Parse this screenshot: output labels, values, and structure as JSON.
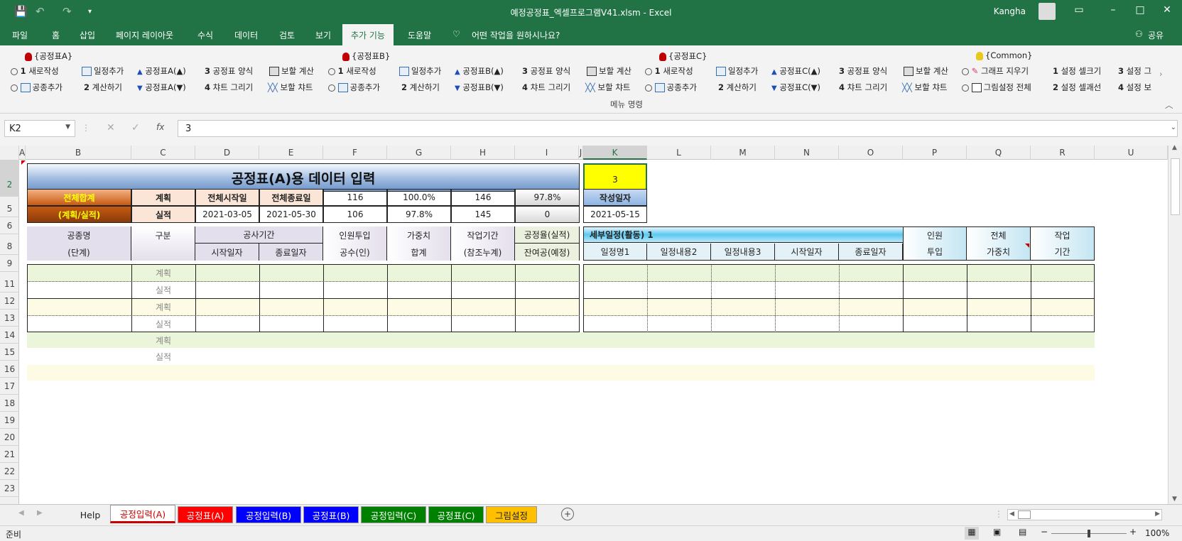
{
  "window": {
    "title": "예정공정표_엑셀프로그램V41.xlsm  -  Excel",
    "user": "Kangha"
  },
  "menu": {
    "tabs": [
      "파일",
      "홈",
      "삽입",
      "페이지 레이아웃",
      "수식",
      "데이터",
      "검토",
      "보기",
      "추가 기능",
      "도움말"
    ],
    "active": "추가 기능",
    "tell_me": "어떤 작업을 원하시나요?",
    "share": "공유"
  },
  "ribbon": {
    "groups": [
      {
        "title": "{공정표A}",
        "bulb": "#c00000",
        "row1": [
          "새로작성",
          "일정추가",
          "공정표A(▲)",
          "공정표 양식",
          "보할 계산"
        ],
        "row2": [
          "공종추가",
          "계산하기",
          "공정표A(▼)",
          "챠트 그리기",
          "보할 챠트"
        ]
      },
      {
        "title": "{공정표B}",
        "bulb": "#c00000",
        "row1": [
          "새로작성",
          "일정추가",
          "공정표B(▲)",
          "공정표 양식",
          "보할 계산"
        ],
        "row2": [
          "공종추가",
          "계산하기",
          "공정표B(▼)",
          "챠트 그리기",
          "보할 챠트"
        ]
      },
      {
        "title": "{공정표C}",
        "bulb": "#c00000",
        "row1": [
          "새로작성",
          "일정추가",
          "공정표C(▲)",
          "공정표 양식",
          "보할 계산"
        ],
        "row2": [
          "공종추가",
          "계산하기",
          "공정표C(▼)",
          "챠트 그리기",
          "보할 챠트"
        ]
      }
    ],
    "common": {
      "title": "{Common}",
      "bulb": "#e8c81a",
      "row1": [
        "그래프 지우기",
        "설정 셀크기",
        "설정 그"
      ],
      "row2": [
        "그림설정 전체",
        "설정 셀괘선",
        "설정 보"
      ]
    },
    "nums": {
      "n1": "1",
      "n2": "2",
      "n3": "3",
      "n4": "4"
    },
    "footer": "메뉴 명령"
  },
  "formula": {
    "namebox": "K2",
    "fx": "fx",
    "value": "3"
  },
  "columns": [
    "A",
    "B",
    "C",
    "D",
    "E",
    "F",
    "G",
    "H",
    "I",
    "J",
    "K",
    "L",
    "M",
    "N",
    "O",
    "P",
    "Q",
    "R",
    "U"
  ],
  "rows": [
    "2",
    "5",
    "6",
    "8",
    "9",
    "11",
    "12",
    "13",
    "14",
    "15",
    "16",
    "17",
    "18",
    "19",
    "20",
    "21",
    "22",
    "23"
  ],
  "sheet": {
    "title": "공정표(A)용 데이터 입력",
    "k2": "3",
    "total_label1": "전체합계",
    "total_label2": "(계획/실적)",
    "plan": "계획",
    "actual": "실적",
    "start_hdr": "전체시작일",
    "end_hdr": "전체종료일",
    "plan_start": "2021-03-05",
    "plan_end": "2021-05-30",
    "f5": "116",
    "g5": "100.0%",
    "h5": "146",
    "i5": "97.8%",
    "f6": "106",
    "g6": "97.8%",
    "h6": "145",
    "i6": "0",
    "date_hdr": "작성일자",
    "date_val": "2021-05-15",
    "h8": {
      "b": "공종명",
      "c": "구분",
      "d": "공사기간",
      "f": "인원투입",
      "g": "가중치",
      "h": "작업기간",
      "i": "공정율(실적)",
      "k": "세부일정(활동)  1",
      "p": "인원",
      "q": "전체",
      "r": "작업"
    },
    "h9": {
      "b": "(단계)",
      "d": "시작일자",
      "e": "종료일자",
      "f": "공수(인)",
      "g": "합계",
      "h": "(참조누계)",
      "i": "잔여공(예정)",
      "k": "일정명1",
      "l": "일정내용2",
      "m": "일정내용3",
      "n": "시작일자",
      "o": "종료일자",
      "p": "투입",
      "q": "가중치",
      "r": "기간"
    }
  },
  "sheet_tabs": [
    "Help",
    "공정입력(A)",
    "공정표(A)",
    "공정입력(B)",
    "공정표(B)",
    "공정입력(C)",
    "공정표(C)",
    "그림설정"
  ],
  "status": {
    "ready": "준비",
    "zoom": "100%"
  },
  "colors": {
    "excel_green": "#217346",
    "header_blue": "#4f81bd",
    "orange": "#c55a11",
    "yellow": "#ffff00"
  }
}
